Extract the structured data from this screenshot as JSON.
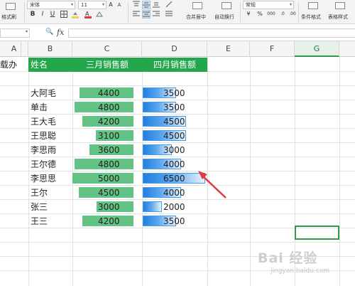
{
  "ribbon": {
    "format_painter_label": "格式刷",
    "font_name": "宋体",
    "font_size": "11",
    "bold": "B",
    "italic": "I",
    "underline": "U",
    "merge_center_label": "合并居中",
    "wrap_text_label": "自动换行",
    "number_format": "常规",
    "conditional_format_label": "条件格式",
    "table_style_label": "表格样式",
    "dropdown_arrow": "▾"
  },
  "formula_bar": {
    "fx_label": "fx",
    "zoom_icon": "🔍"
  },
  "columns": [
    "A",
    "B",
    "C",
    "D",
    "E",
    "F",
    "G"
  ],
  "active_column": "G",
  "cut_text": "载办",
  "headers": {
    "name": "姓名",
    "march": "三月销售额",
    "april": "四月销售额"
  },
  "rows": [
    {
      "name": "大阿毛",
      "march": "4400",
      "april": "3500"
    },
    {
      "name": "单击",
      "march": "4800",
      "april": "3500"
    },
    {
      "name": "王大毛",
      "march": "4200",
      "april": "4500"
    },
    {
      "name": "王思聪",
      "march": "3100",
      "april": "4500"
    },
    {
      "name": "李思雨",
      "march": "3600",
      "april": "3000"
    },
    {
      "name": "王尔德",
      "march": "4800",
      "april": "4000"
    },
    {
      "name": "李思思",
      "march": "5000",
      "april": "6500"
    },
    {
      "name": "王尔",
      "march": "4500",
      "april": "4000"
    },
    {
      "name": "张三",
      "march": "3000",
      "april": "2000"
    },
    {
      "name": "王三",
      "march": "4200",
      "april": "3500"
    }
  ],
  "databars": {
    "march_max": 5000,
    "april_max": 6500,
    "march_color": "#63c384",
    "april_color": "#1f7fe0"
  },
  "colors": {
    "header_fill": "#22a84a",
    "selection_border": "#2e9a4a",
    "arrow": "#e23a3a"
  },
  "watermark": {
    "line1": "Bai 经验",
    "line2": "jingyan.baidu.com"
  }
}
